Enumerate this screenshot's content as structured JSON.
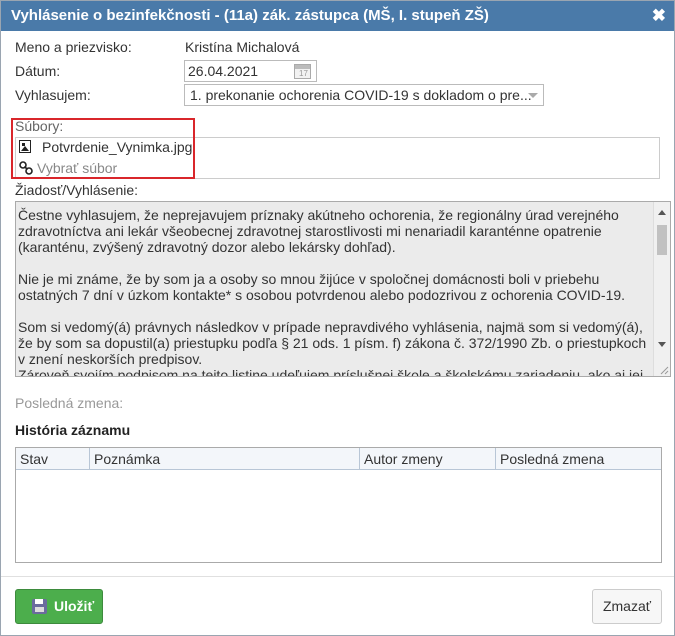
{
  "dialog": {
    "title": "Vyhlásenie o bezinfekčnosti - (11a) zák. zástupca (MŠ, I. stupeň ZŠ)",
    "close_glyph": "✖"
  },
  "form": {
    "name_label": "Meno a priezvisko:",
    "name_value": "Kristína Michalová",
    "date_label": "Dátum:",
    "date_value": "26.04.2021",
    "calendar_day": "17",
    "declare_label": "Vyhlasujem:",
    "declare_value": "1. prekonanie ochorenia COVID-19 s dokladom o pre...",
    "files_label": "Súbory:",
    "file_name": "Potvrdenie_Vynimka.jpg",
    "choose_file": "Vybrať súbor",
    "request_label": "Žiadosť/Vyhlásenie:",
    "request_paragraphs": [
      "Čestne vyhlasujem, že neprejavujem príznaky akútneho ochorenia, že regionálny úrad verejného zdravotníctva ani lekár všeobecnej zdravotnej starostlivosti mi nenariadil karanténne opatrenie (karanténu, zvýšený zdravotný dozor alebo lekársky dohľad).",
      "Nie je mi známe, že by som ja a osoby so mnou žijúce v spoločnej domácnosti boli v priebehu ostatných 7 dní v úzkom kontakte* s osobou potvrdenou alebo podozrivou z ochorenia COVID-19.",
      "Som si vedomý(á) právnych následkov v prípade nepravdivého vyhlásenia, najmä som si vedomý(á), že by som sa dopustil(a) priestupku podľa § 21 ods. 1 písm. f) zákona č. 372/1990 Zb. o priestupkoch v znení neskorších predpisov.",
      "Zároveň svojím podpisom na tejto listine udeľujem príslušnej škole a školskému zariadeniu, ako aj jej zriaďovateľovi a Ministerstvu školstva, vedy, výskumu a športu Slovenskej republiky dobrovoľne súhlas"
    ],
    "last_change_label": "Posledná zmena:"
  },
  "history": {
    "title": "História záznamu",
    "columns": [
      "Stav",
      "Poznámka",
      "Autor zmeny",
      "Posledná zmena"
    ]
  },
  "footer": {
    "save_label": "Uložiť",
    "delete_label": "Zmazať"
  },
  "colors": {
    "titlebar": "#4a7aa9",
    "save_button": "#4cae4c",
    "highlight": "#d9262b"
  }
}
